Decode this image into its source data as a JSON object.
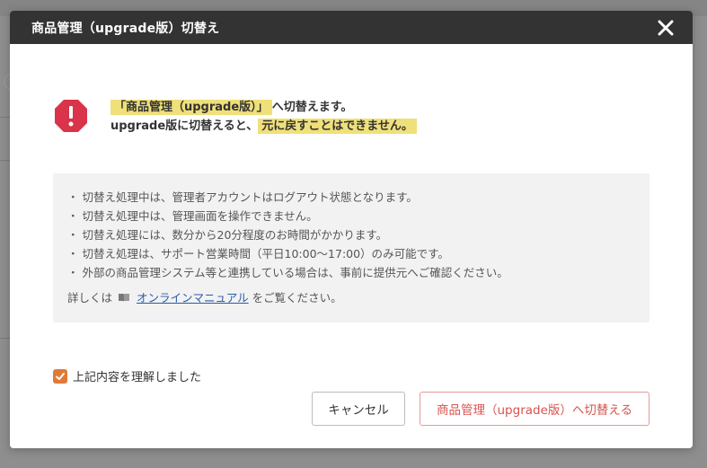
{
  "dialog": {
    "title": "商品管理（upgrade版）切替え",
    "close_icon": "close-icon"
  },
  "warning": {
    "icon": "alert-octagon-icon",
    "icon_color": "#d9344a",
    "line1_highlight": "「商品管理（upgrade版）」",
    "line1_rest": "へ切替えます。",
    "line2_prefix": "upgrade版に切替えると、",
    "line2_highlight": "元に戻すことはできません。",
    "highlight_color": "#efe07a"
  },
  "info": {
    "items": [
      "切替え処理中は、管理者アカウントはログアウト状態となります。",
      "切替え処理中は、管理画面を操作できません。",
      "切替え処理には、数分から20分程度のお時間がかかります。",
      "切替え処理は、サポート営業時間（平日10:00〜17:00）のみ可能です。",
      "外部の商品管理システム等と連携している場合は、事前に提供元へご確認ください。"
    ],
    "footer_prefix": "詳しくは",
    "footer_icon": "book-icon",
    "manual_link": "オンラインマニュアル",
    "footer_suffix": "をご覧ください。"
  },
  "agreement": {
    "label": "上記内容を理解しました",
    "checked": true,
    "checkbox_color": "#e07a37"
  },
  "buttons": {
    "cancel": "キャンセル",
    "switch": "商品管理（upgrade版）へ切替える"
  }
}
